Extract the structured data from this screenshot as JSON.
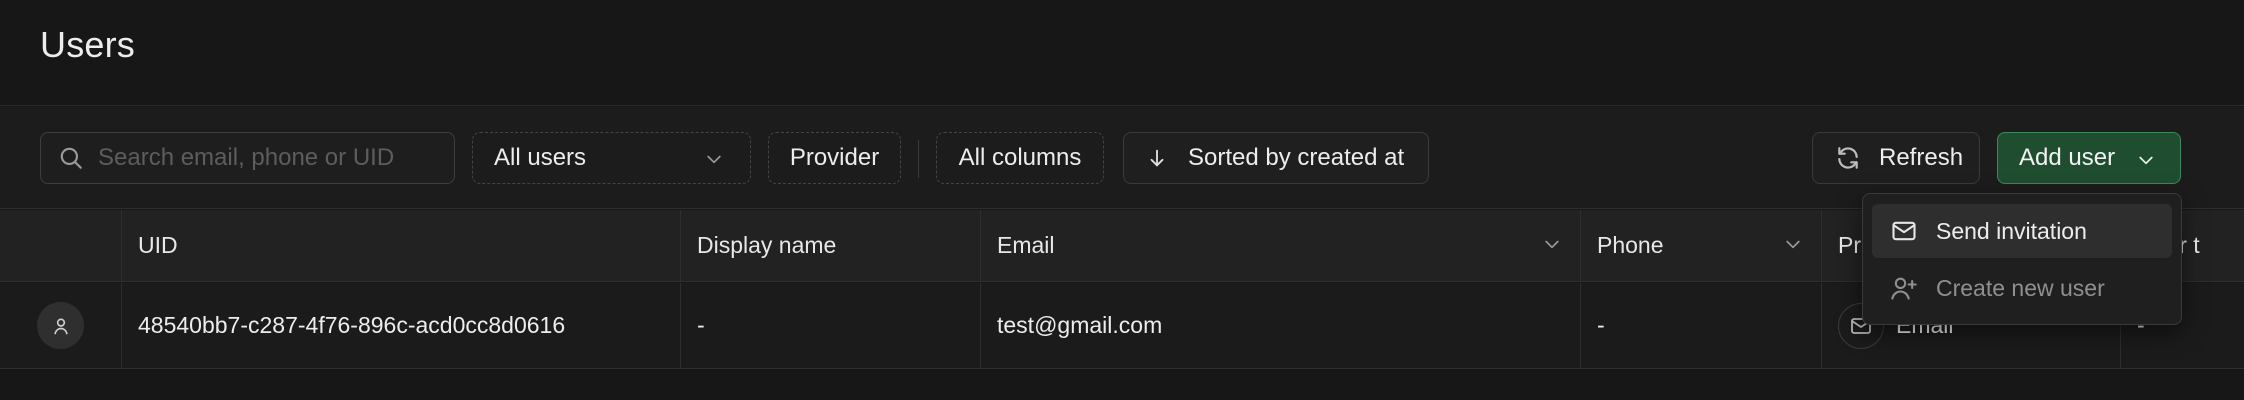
{
  "header": {
    "title": "Users"
  },
  "toolbar": {
    "search_placeholder": "Search email, phone or UID",
    "filter_users": "All users",
    "provider": "Provider",
    "columns": "All columns",
    "sort": "Sorted by created at",
    "refresh": "Refresh",
    "add_user": "Add user"
  },
  "add_user_menu": {
    "items": [
      {
        "label": "Send invitation",
        "icon": "mail-icon"
      },
      {
        "label": "Create new user",
        "icon": "user-plus-icon"
      }
    ]
  },
  "table": {
    "columns": [
      "UID",
      "Display name",
      "Email",
      "Phone",
      "Pr",
      "vider t"
    ],
    "rows": [
      {
        "uid": "48540bb7-c287-4f76-896c-acd0cc8d0616",
        "display_name": "-",
        "email": "test@gmail.com",
        "phone": "-",
        "provider": "Email",
        "provider_type": "-"
      }
    ]
  },
  "colors": {
    "background": "#171717",
    "accent_green_bg": "#1e4d2f",
    "accent_green_border": "#3c8a58",
    "text": "#ededed",
    "muted_text": "#8f8f8f"
  }
}
